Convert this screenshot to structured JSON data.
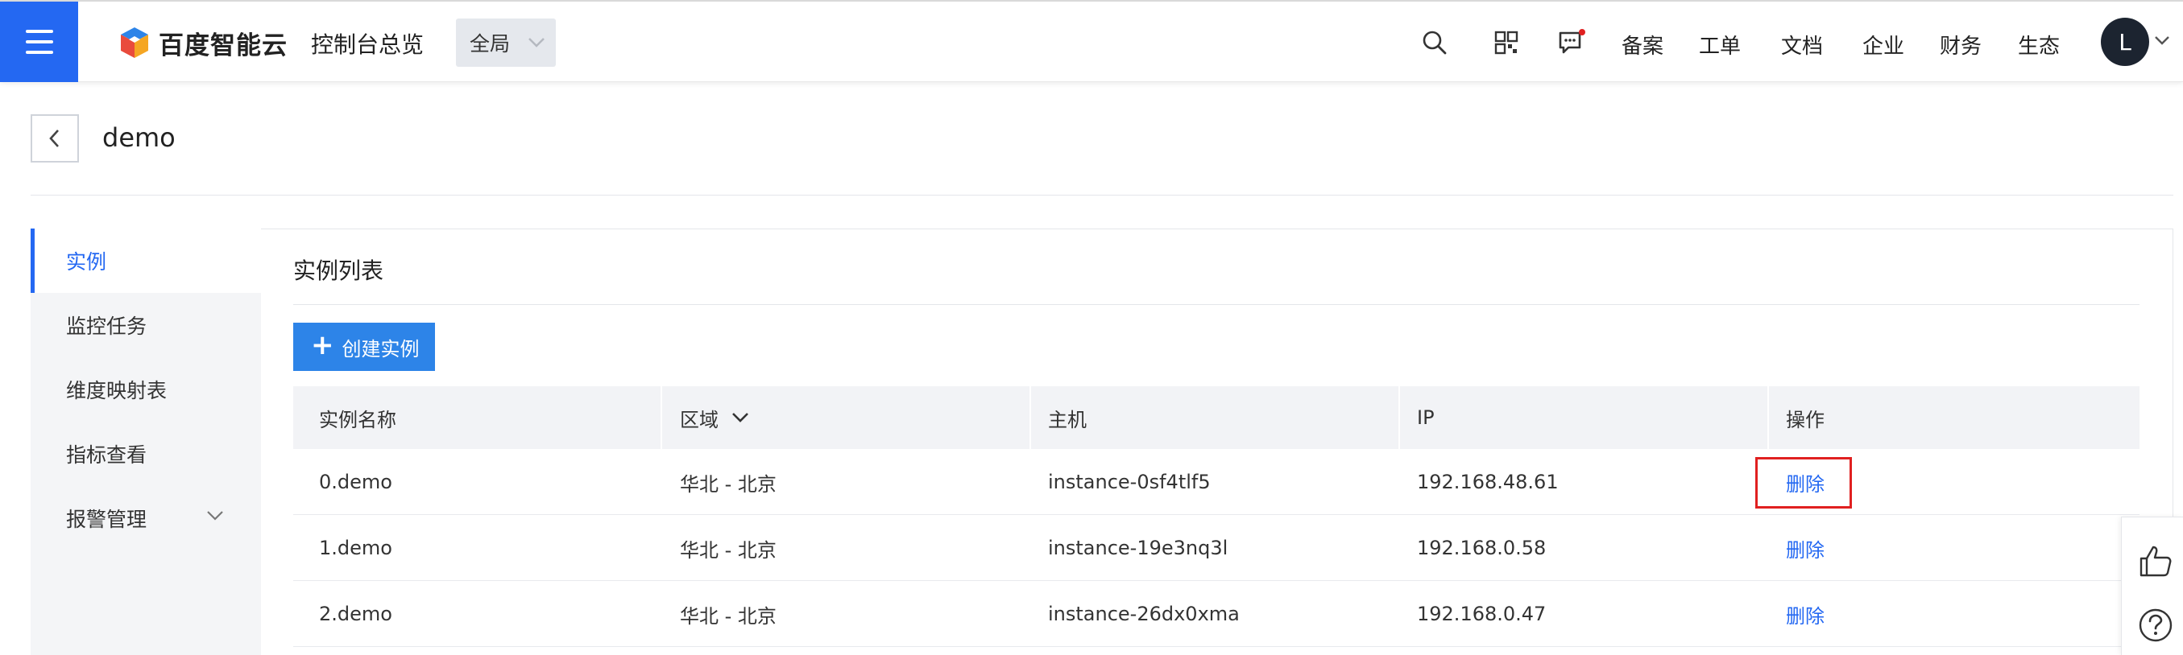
{
  "topbar": {
    "logo_text": "百度智能云",
    "console_label": "控制台总览",
    "region_label": "全局",
    "nav_links": [
      "备案",
      "工单",
      "文档",
      "企业",
      "财务",
      "生态"
    ],
    "avatar_letter": "L",
    "brand_color": "#2468f2",
    "icons": [
      "menu-icon",
      "search-icon",
      "qrcode-icon",
      "message-icon",
      "chevron-down-icon"
    ]
  },
  "page": {
    "title": "demo"
  },
  "sidebar": {
    "items": [
      {
        "label": "实例",
        "active": true
      },
      {
        "label": "监控任务",
        "active": false
      },
      {
        "label": "维度映射表",
        "active": false
      },
      {
        "label": "指标查看",
        "active": false
      },
      {
        "label": "报警管理",
        "active": false,
        "expandable": true
      }
    ]
  },
  "main": {
    "section_title": "实例列表",
    "create_button": "创建实例",
    "table": {
      "columns": [
        "实例名称",
        "区域",
        "主机",
        "IP",
        "操作"
      ],
      "rows": [
        {
          "name": "0.demo",
          "region": "华北 - 北京",
          "host": "instance-0sf4tlf5",
          "ip": "192.168.48.61",
          "action": "删除"
        },
        {
          "name": "1.demo",
          "region": "华北 - 北京",
          "host": "instance-19e3nq3l",
          "ip": "192.168.0.58",
          "action": "删除"
        },
        {
          "name": "2.demo",
          "region": "华北 - 北京",
          "host": "instance-26dx0xma",
          "ip": "192.168.0.47",
          "action": "删除"
        }
      ]
    }
  },
  "float_tools": [
    "thumbs-up-icon",
    "help-icon"
  ],
  "colors": {
    "accent": "#2468f2",
    "create_button": "#2d84e8",
    "highlight": "#e02020"
  }
}
